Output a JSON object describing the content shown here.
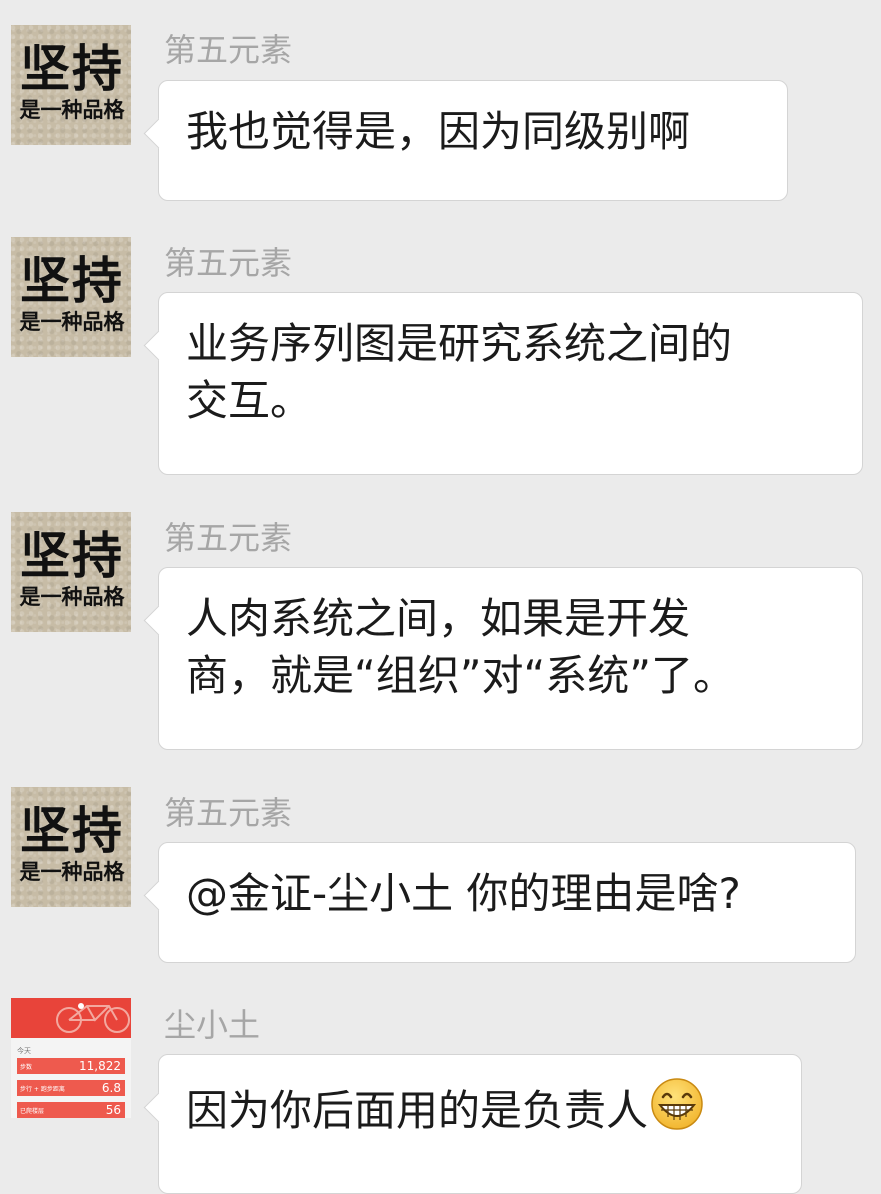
{
  "messages": [
    {
      "sender": "第五元素",
      "avatar": {
        "type": "brand",
        "big_text": "坚持",
        "small_text": "是一种品格"
      },
      "lines": [
        "我也觉得是，因为同级别啊"
      ]
    },
    {
      "sender": "第五元素",
      "avatar": {
        "type": "brand",
        "big_text": "坚持",
        "small_text": "是一种品格"
      },
      "lines": [
        "业务序列图是研究系统之间的",
        "交互。"
      ]
    },
    {
      "sender": "第五元素",
      "avatar": {
        "type": "brand",
        "big_text": "坚持",
        "small_text": "是一种品格"
      },
      "lines": [
        "人肉系统之间，如果是开发",
        "商，就是“组织”对“系统”了。"
      ]
    },
    {
      "sender": "第五元素",
      "avatar": {
        "type": "brand",
        "big_text": "坚持",
        "small_text": "是一种品格"
      },
      "lines": [
        "@金证-尘小土 你的理由是啥?"
      ]
    },
    {
      "sender": "尘小土",
      "avatar": {
        "type": "photo",
        "label": "今天",
        "rows": [
          {
            "key": "步数",
            "value": "11,822"
          },
          {
            "key": "步行 + 跑步距离",
            "value": "6.8"
          },
          {
            "key": "已爬楼层",
            "value": "56"
          }
        ]
      },
      "lines": [
        "因为你后面用的是负责人"
      ],
      "emoji": "grinning-face-emoji"
    }
  ]
}
